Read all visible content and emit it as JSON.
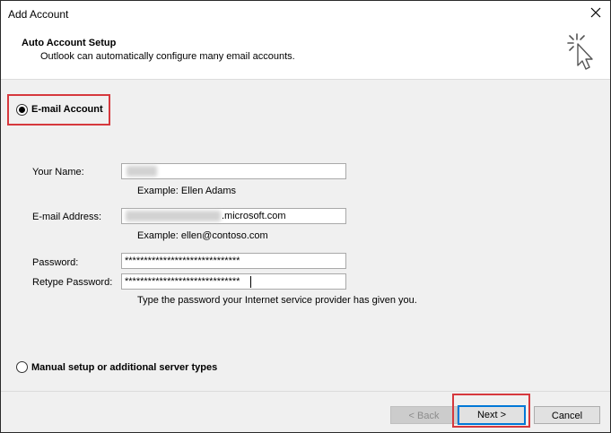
{
  "window": {
    "title": "Add Account"
  },
  "header": {
    "title": "Auto Account Setup",
    "subtitle": "Outlook can automatically configure many email accounts."
  },
  "options": {
    "email_account": {
      "label": "E-mail Account",
      "selected": true
    },
    "manual_setup": {
      "label": "Manual setup or additional server types",
      "selected": false
    }
  },
  "form": {
    "name": {
      "label": "Your Name:",
      "value": "",
      "hint": "Example: Ellen Adams"
    },
    "email": {
      "label": "E-mail Address:",
      "value_suffix": ".microsoft.com",
      "hint": "Example: ellen@contoso.com"
    },
    "password": {
      "label": "Password:",
      "value": "******************************"
    },
    "retype_password": {
      "label": "Retype Password:",
      "value": "******************************"
    },
    "password_hint": "Type the password your Internet service provider has given you."
  },
  "buttons": {
    "back": "< Back",
    "next": "Next >",
    "cancel": "Cancel"
  },
  "colors": {
    "highlight": "#d6383d",
    "default_button_border": "#0078d7"
  }
}
